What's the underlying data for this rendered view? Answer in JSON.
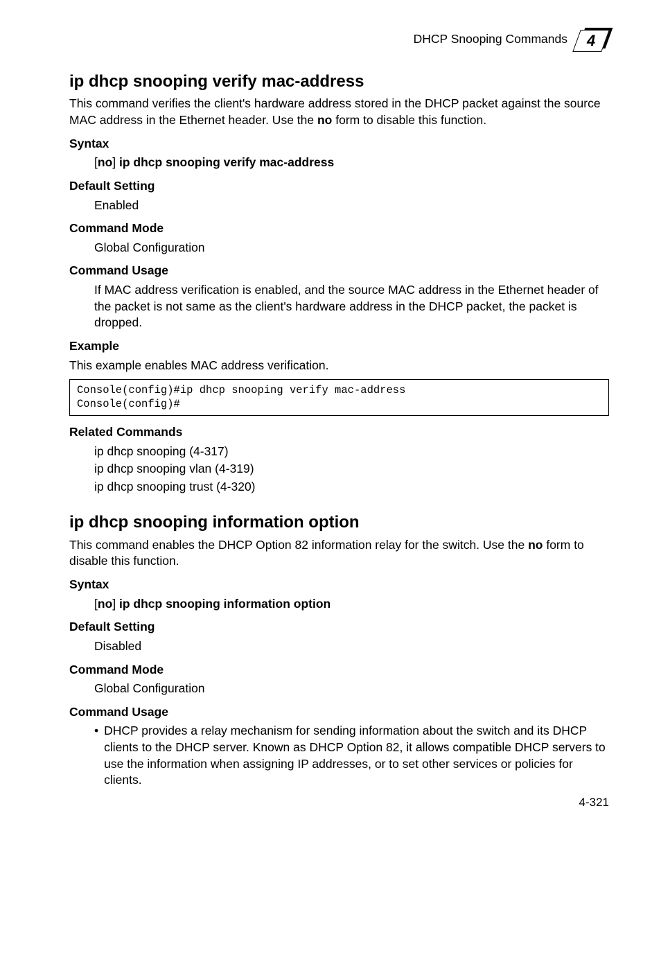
{
  "header": {
    "running_title": "DHCP Snooping Commands",
    "chapter_number": "4"
  },
  "section1": {
    "title": "ip dhcp snooping verify mac-address",
    "intro_prefix": "This command verifies the client's hardware address stored in the DHCP packet against the source MAC address in the Ethernet header. Use the ",
    "intro_bold": "no",
    "intro_suffix": " form to disable this function.",
    "syntax_label": "Syntax",
    "syntax_no": "no",
    "syntax_cmd": " ip dhcp snooping verify mac-address",
    "default_label": "Default Setting",
    "default_value": "Enabled",
    "mode_label": "Command Mode",
    "mode_value": "Global Configuration",
    "usage_label": "Command Usage",
    "usage_text": "If MAC address verification is enabled, and the source MAC address in the Ethernet header of the packet is not same as the client's hardware address in the DHCP packet, the packet is dropped.",
    "example_label": "Example",
    "example_intro": "This example enables MAC address verification.",
    "example_code": "Console(config)#ip dhcp snooping verify mac-address\nConsole(config)#",
    "related_label": "Related Commands",
    "related_items": [
      "ip dhcp snooping (4-317)",
      "ip dhcp snooping vlan (4-319)",
      "ip dhcp snooping trust (4-320)"
    ]
  },
  "section2": {
    "title": "ip dhcp snooping information option",
    "intro_prefix": "This command enables the DHCP Option 82 information relay for the switch. Use the ",
    "intro_bold": "no",
    "intro_suffix": " form to disable this function.",
    "syntax_label": "Syntax",
    "syntax_no": "no",
    "syntax_cmd": " ip dhcp snooping information option",
    "default_label": "Default Setting",
    "default_value": "Disabled",
    "mode_label": "Command Mode",
    "mode_value": "Global Configuration",
    "usage_label": "Command Usage",
    "usage_bullet": "DHCP provides a relay mechanism for sending information about the switch and its DHCP clients to the DHCP server. Known as DHCP Option 82, it allows compatible DHCP servers to use the information when assigning IP addresses, or to set other services or policies for clients."
  },
  "page_number": "4-321"
}
